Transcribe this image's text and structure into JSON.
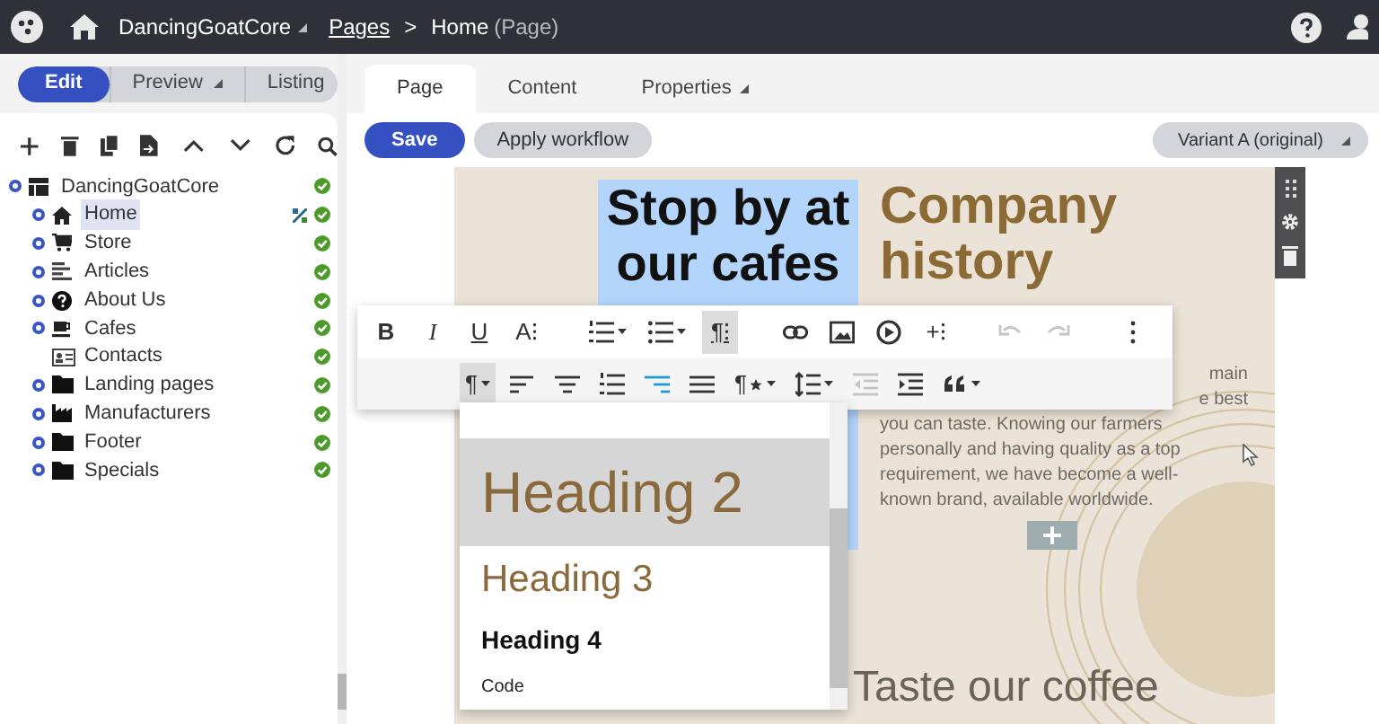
{
  "header": {
    "site": "DancingGoatCore",
    "breadcrumb_link": "Pages",
    "separator": ">",
    "current": "Home",
    "current_type": "(Page)"
  },
  "mode_switch": [
    {
      "label": "Edit",
      "selected": true,
      "caret": false
    },
    {
      "label": "Preview",
      "selected": false,
      "caret": true
    },
    {
      "label": "Listing",
      "selected": false,
      "caret": false
    }
  ],
  "tabs": [
    {
      "label": "Page",
      "selected": true,
      "caret": false
    },
    {
      "label": "Content",
      "selected": false,
      "caret": false
    },
    {
      "label": "Properties",
      "selected": false,
      "caret": true
    }
  ],
  "actions": {
    "save": "Save",
    "apply_workflow": "Apply workflow",
    "variant": "Variant A (original)"
  },
  "tree": {
    "label": "DancingGoatCore",
    "kind": "root",
    "expandable": true,
    "selected": false,
    "variants": false,
    "children": [
      {
        "label": "Home",
        "kind": "home",
        "expandable": true,
        "selected": true,
        "variants": true
      },
      {
        "label": "Store",
        "kind": "store",
        "expandable": true,
        "selected": false,
        "variants": false
      },
      {
        "label": "Articles",
        "kind": "articles",
        "expandable": true,
        "selected": false,
        "variants": false
      },
      {
        "label": "About Us",
        "kind": "about",
        "expandable": true,
        "selected": false,
        "variants": false
      },
      {
        "label": "Cafes",
        "kind": "cafes",
        "expandable": true,
        "selected": false,
        "variants": false
      },
      {
        "label": "Contacts",
        "kind": "contacts",
        "expandable": false,
        "selected": false,
        "variants": false
      },
      {
        "label": "Landing pages",
        "kind": "folder",
        "expandable": true,
        "selected": false,
        "variants": false
      },
      {
        "label": "Manufacturers",
        "kind": "factory",
        "expandable": true,
        "selected": false,
        "variants": false
      },
      {
        "label": "Footer",
        "kind": "folder",
        "expandable": true,
        "selected": false,
        "variants": false
      },
      {
        "label": "Specials",
        "kind": "folder",
        "expandable": true,
        "selected": false,
        "variants": false
      }
    ]
  },
  "editor": {
    "heading_left": {
      "text": "Stop by at our cafes",
      "selected": true
    },
    "heading_right": "Company history",
    "paragraph": [
      {
        "text": "main",
        "partial": true
      },
      {
        "text": "e best",
        "partial": true
      },
      {
        "text": "you can taste. Knowing our farmers",
        "partial": false
      },
      {
        "text": "personally and having quality as a top",
        "partial": false
      },
      {
        "text": "requirement, we have become a well-",
        "partial": false
      },
      {
        "text": "known brand, available worldwide.",
        "partial": false
      }
    ],
    "bottom_heading": "Taste our coffee"
  },
  "toolbar": {
    "rows": [
      [
        [
          {
            "kind": "text",
            "label": "B",
            "active": false,
            "disabled": false,
            "caret": false
          },
          {
            "kind": "text",
            "label": "I",
            "active": false,
            "disabled": false,
            "caret": false
          },
          {
            "kind": "text",
            "label": "U",
            "active": false,
            "disabled": false,
            "caret": false
          },
          {
            "kind": "text",
            "label": "A⁝",
            "active": false,
            "disabled": false,
            "caret": false
          }
        ],
        [
          {
            "kind": "numbered-list",
            "active": false,
            "disabled": false,
            "caret": true
          },
          {
            "kind": "bullet-list",
            "active": false,
            "disabled": false,
            "caret": true
          },
          {
            "kind": "text",
            "label": "¶⁝",
            "active": true,
            "disabled": false,
            "caret": false
          }
        ],
        [
          {
            "kind": "link",
            "active": false,
            "disabled": false,
            "caret": false
          },
          {
            "kind": "image",
            "active": false,
            "disabled": false,
            "caret": false
          },
          {
            "kind": "video",
            "active": false,
            "disabled": false,
            "caret": false
          },
          {
            "kind": "text",
            "label": "+⁝",
            "active": false,
            "disabled": false,
            "caret": false
          }
        ],
        [
          {
            "kind": "undo",
            "active": false,
            "disabled": true,
            "caret": false
          },
          {
            "kind": "redo",
            "active": false,
            "disabled": true,
            "caret": false
          }
        ],
        [
          {
            "kind": "more",
            "active": false,
            "disabled": false,
            "caret": false
          }
        ]
      ],
      [
        [
          {
            "kind": "text",
            "label": "¶",
            "active": true,
            "disabled": false,
            "caret": true
          },
          {
            "kind": "align-left",
            "active": false,
            "disabled": false,
            "caret": false
          },
          {
            "kind": "align-center",
            "active": false,
            "disabled": false,
            "caret": false
          },
          {
            "kind": "numbered-list",
            "active": false,
            "disabled": false,
            "caret": false
          },
          {
            "kind": "align-right",
            "active": true,
            "disabled": false,
            "caret": false
          },
          {
            "kind": "align-justify",
            "active": false,
            "disabled": false,
            "caret": false
          },
          {
            "kind": "paragraph-style",
            "label": "¶",
            "active": false,
            "disabled": false,
            "caret": true
          },
          {
            "kind": "line-height",
            "active": false,
            "disabled": false,
            "caret": true
          },
          {
            "kind": "outdent",
            "active": false,
            "disabled": true,
            "caret": false
          },
          {
            "kind": "indent",
            "active": false,
            "disabled": false,
            "caret": false
          },
          {
            "kind": "quote",
            "active": false,
            "disabled": false,
            "caret": true
          }
        ]
      ]
    ]
  },
  "format_menu": [
    {
      "label": "Heading 2",
      "kind": "h2",
      "selected": true
    },
    {
      "label": "Heading 3",
      "kind": "h3",
      "selected": false
    },
    {
      "label": "Heading 4",
      "kind": "h4",
      "selected": false
    },
    {
      "label": "Code",
      "kind": "code",
      "selected": false
    }
  ]
}
